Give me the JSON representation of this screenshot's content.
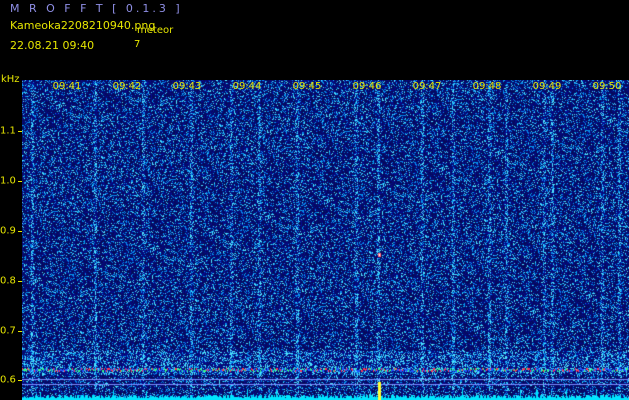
{
  "app": {
    "title": "M R O F F T  [ 0.1.3 ]"
  },
  "info": {
    "file_name": "Kameoka2208210940.png",
    "meteor_label": "meteor",
    "date_time": "22.08.21 09:40",
    "meteor_count": "7"
  },
  "axis": {
    "unit": "kHz",
    "time_labels": [
      "09:41",
      "09:42",
      "09:43",
      "09:44",
      "09:45",
      "09:46",
      "09:47",
      "09:48",
      "09:49",
      "09:50"
    ],
    "freq_labels": [
      "1.1",
      "1.0",
      "0.9",
      "0.8",
      "0.7",
      "0.6"
    ]
  },
  "colors": {
    "background": "#000000",
    "noise": "#0a1a8c",
    "text": "#e6e600",
    "title": "#8f8fe6",
    "baseline": "#00e5ff"
  }
}
